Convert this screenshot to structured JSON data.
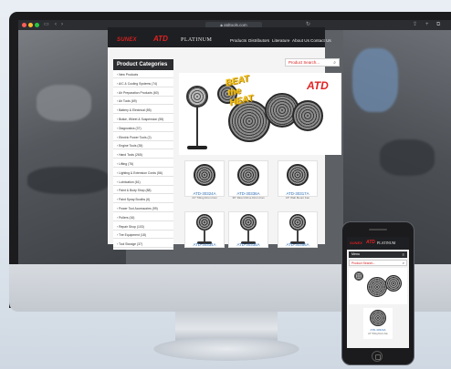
{
  "browser": {
    "url": "atdtools.com"
  },
  "site": {
    "logo_sunex": "SUNEX",
    "logo_atd": "ATD",
    "logo_platinum": "PLATINUM",
    "nav": [
      "Products",
      "Distributors",
      "Literature",
      "About Us",
      "Contact Us"
    ],
    "search_placeholder": "Product Search...",
    "sidebar_title": "Product Categories",
    "categories": [
      "New Products",
      "A/C & Cooling Systems (74)",
      "Air Preparation Products (60)",
      "Air Tools (69)",
      "Battery & Electrical (55)",
      "Brake, Wheel & Suspension (55)",
      "Diagnostics (37)",
      "Electric Power Tools (2)",
      "Engine Tools (35)",
      "Hand Tools (265)",
      "Lifting (76)",
      "Lighting & Extension Cords (56)",
      "Lubrication (61)",
      "Paint & Body Shop (88)",
      "Paint Spray Booths (6)",
      "Power Tool Accessories (99)",
      "Pullers (16)",
      "Repair Shop (103)",
      "Tire Equipment (18)",
      "Tool Storage (37)"
    ],
    "banner_text": "BEAT the HEAT",
    "banner_brand": "ATD",
    "products": [
      {
        "sku": "ATD-30324A",
        "desc": "24\" Tilting Drum Fan"
      },
      {
        "sku": "ATD-30336A",
        "desc": "36\" Direct Drive Drum Fan"
      },
      {
        "sku": "ATD-30317A",
        "desc": "18\" Wall Mount Fan"
      },
      {
        "sku": "ATD-30334A",
        "desc": "Pedestal Fan"
      },
      {
        "sku": "ATD-30335A",
        "desc": "Pedestal Fan"
      },
      {
        "sku": "ATD-30356A",
        "desc": "Wall Mount Fan"
      }
    ]
  },
  "phone": {
    "menu_label": "Menu",
    "search_placeholder": "Product Search...",
    "product_sku": "ATD-30324A",
    "product_desc": "24\" Tilting Drum Fan"
  },
  "colors": {
    "brand_red": "#e02222",
    "link_blue": "#2f6fb6",
    "header_dark": "#1e1f22"
  }
}
